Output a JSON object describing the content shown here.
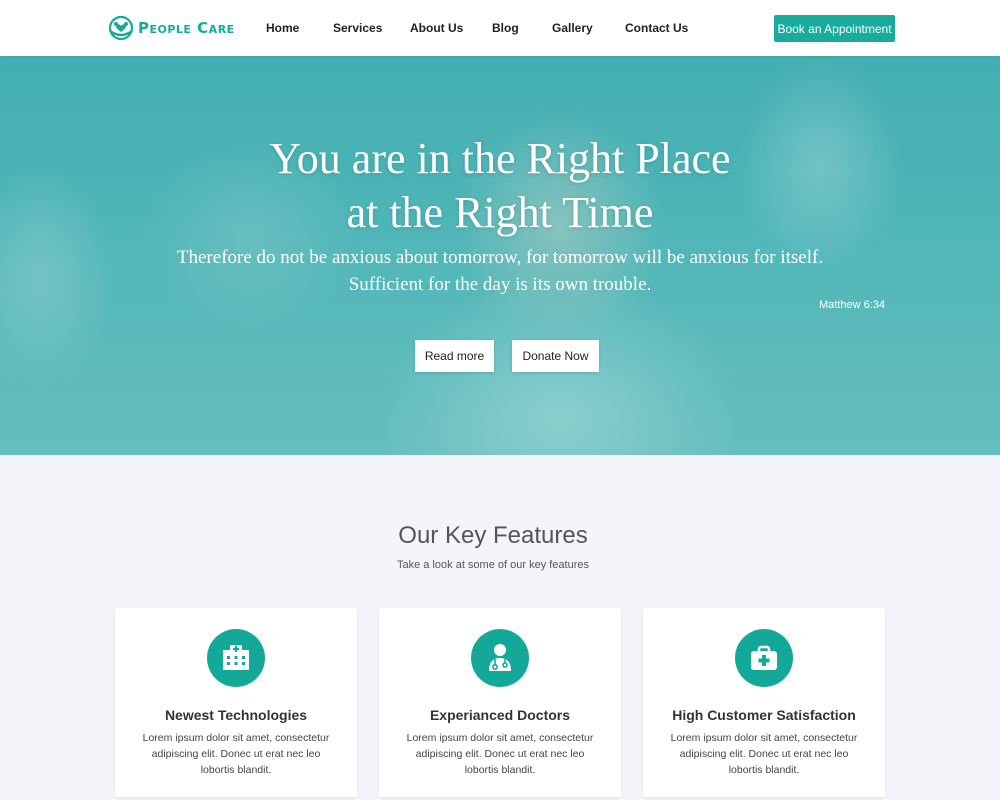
{
  "header": {
    "logo_text": "People Care",
    "nav": [
      "Home",
      "Services",
      "About Us",
      "Blog",
      "Gallery",
      "Contact Us"
    ],
    "cta_label": "Book an Appointment"
  },
  "hero": {
    "title_line1": "You are in the Right Place",
    "title_line2": "at the Right Time",
    "quote_line1": "Therefore do not be anxious about tomorrow, for tomorrow will be anxious for itself.",
    "quote_line2": "Sufficient for the day is its own trouble.",
    "reference": "Matthew 6:34",
    "read_more_label": "Read more",
    "donate_label": "Donate Now"
  },
  "features": {
    "title": "Our Key Features",
    "subtitle": "Take a look at some of our key features",
    "cards": [
      {
        "icon": "hospital-icon",
        "title": "Newest Technologies",
        "text": "Lorem ipsum dolor sit amet, consectetur adipiscing elit. Donec ut erat nec leo lobortis blandit."
      },
      {
        "icon": "doctor-icon",
        "title": "Experianced Doctors",
        "text": "Lorem ipsum dolor sit amet, consectetur adipiscing elit. Donec ut erat nec leo lobortis blandit."
      },
      {
        "icon": "medical-kit-icon",
        "title": "High Customer Satisfaction",
        "text": "Lorem ipsum dolor sit amet, consectetur adipiscing elit. Donec ut erat nec leo lobortis blandit."
      }
    ]
  },
  "colors": {
    "accent": "#19ab9c",
    "hero": "#4fb3b9",
    "background": "#f4f5fb"
  }
}
